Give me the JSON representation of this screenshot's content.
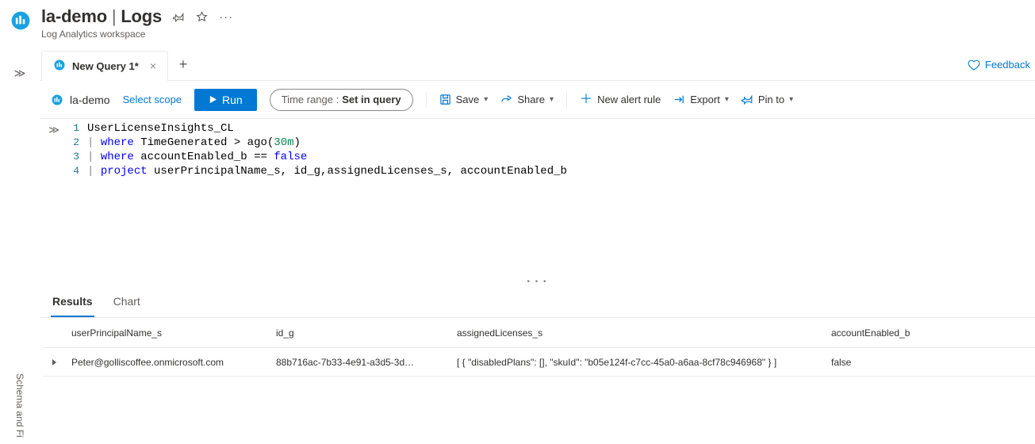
{
  "header": {
    "workspace_name": "la-demo",
    "title_separator": "|",
    "blade_name": "Logs",
    "subtitle": "Log Analytics workspace"
  },
  "tabs": {
    "active": {
      "label": "New Query 1*"
    }
  },
  "feedback": {
    "label": "Feedback"
  },
  "toolbar": {
    "scope_workspace": "la-demo",
    "select_scope": "Select scope",
    "run_label": "Run",
    "time_range_label": "Time range :",
    "time_range_value": "Set in query",
    "save_label": "Save",
    "share_label": "Share",
    "new_alert_rule_label": "New alert rule",
    "export_label": "Export",
    "pin_to_label": "Pin to"
  },
  "editor": {
    "lines": [
      {
        "n": 1,
        "tokens": [
          [
            "ident",
            "UserLicenseInsights_CL"
          ]
        ]
      },
      {
        "n": 2,
        "tokens": [
          [
            "pipe",
            "| "
          ],
          [
            "kw",
            "where"
          ],
          [
            "ident",
            " TimeGenerated "
          ],
          [
            "op",
            "> "
          ],
          [
            "ident",
            "ago"
          ],
          [
            "op",
            "("
          ],
          [
            "num",
            "30m"
          ],
          [
            "op",
            ")"
          ]
        ]
      },
      {
        "n": 3,
        "tokens": [
          [
            "pipe",
            "| "
          ],
          [
            "kw",
            "where"
          ],
          [
            "ident",
            " accountEnabled_b "
          ],
          [
            "op",
            "== "
          ],
          [
            "kw",
            "false"
          ]
        ]
      },
      {
        "n": 4,
        "tokens": [
          [
            "pipe",
            "| "
          ],
          [
            "kw",
            "project"
          ],
          [
            "ident",
            " userPrincipalName_s, id_g,assignedLicenses_s, accountEnabled_b"
          ]
        ]
      }
    ]
  },
  "results": {
    "tabs": {
      "results": "Results",
      "chart": "Chart"
    },
    "columns": [
      "userPrincipalName_s",
      "id_g",
      "assignedLicenses_s",
      "accountEnabled_b"
    ],
    "rows": [
      {
        "userPrincipalName_s": "Peter@golliscoffee.onmicrosoft.com",
        "id_g": "88b716ac-7b33-4e91-a3d5-3d…",
        "assignedLicenses_s": "[ { \"disabledPlans\": [], \"skuId\": \"b05e124f-c7cc-45a0-a6aa-8cf78c946968\" } ]",
        "accountEnabled_b": "false"
      }
    ]
  },
  "sidebar": {
    "label": "Schema and Fi"
  }
}
